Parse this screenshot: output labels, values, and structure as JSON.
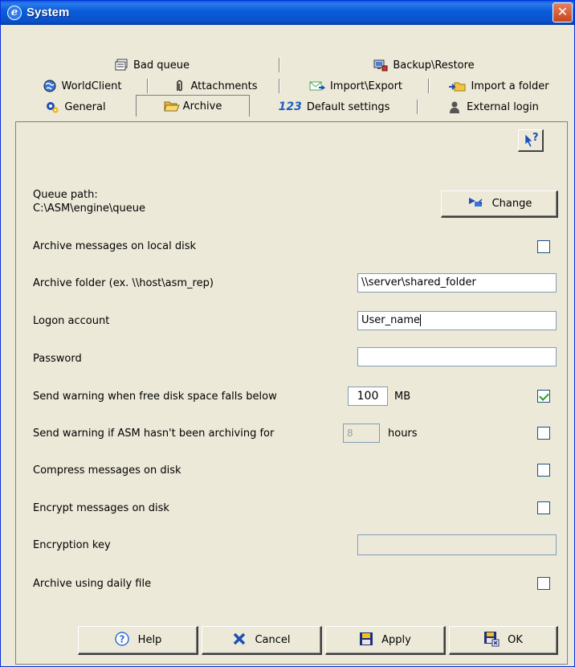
{
  "window": {
    "title": "System",
    "close_symbol": "✕"
  },
  "tabs": {
    "row1": [
      {
        "label": "Bad queue",
        "icon": "queue-icon"
      },
      {
        "label": "Backup\\Restore",
        "icon": "backup-icon"
      }
    ],
    "row2": [
      {
        "label": "WorldClient",
        "icon": "globe-icon"
      },
      {
        "label": "Attachments",
        "icon": "paperclip-icon"
      },
      {
        "label": "Import\\Export",
        "icon": "import-export-icon"
      },
      {
        "label": "Import a folder",
        "icon": "folder-import-icon"
      }
    ],
    "row3": [
      {
        "label": "General",
        "icon": "gear-icon"
      },
      {
        "label": "Archive",
        "icon": "folder-open-icon",
        "active": true
      },
      {
        "label": "Default settings",
        "icon": "numbers-icon",
        "icon_text": "123"
      },
      {
        "label": "External login",
        "icon": "user-icon"
      }
    ]
  },
  "context_help": {
    "icon": "whats-this-icon",
    "symbol": "?"
  },
  "queue": {
    "label": "Queue path:",
    "path": "C:\\ASM\\engine\\queue",
    "change_label": "Change"
  },
  "options": {
    "archive_local": {
      "label": "Archive messages on local disk",
      "checked": false
    },
    "archive_folder": {
      "label": "Archive folder (ex. \\\\host\\asm_rep)",
      "value": "\\\\server\\shared_folder"
    },
    "logon_account": {
      "label": "Logon account",
      "value": "User_name"
    },
    "password": {
      "label": "Password",
      "value": ""
    },
    "disk_warning": {
      "label": "Send warning when free disk space falls below",
      "value": "100",
      "unit": "MB",
      "checked": true
    },
    "archiving_warning": {
      "label": "Send warning if ASM hasn't been archiving for",
      "value": "8",
      "unit": "hours",
      "checked": false
    },
    "compress": {
      "label": "Compress messages on disk",
      "checked": false
    },
    "encrypt": {
      "label": "Encrypt messages on disk",
      "checked": false
    },
    "encryption_key": {
      "label": "Encryption key",
      "value": ""
    },
    "daily_file": {
      "label": "Archive using daily file",
      "checked": false
    }
  },
  "buttons": {
    "help": "Help",
    "cancel": "Cancel",
    "apply": "Apply",
    "ok": "OK"
  },
  "colors": {
    "titlebar": "#0a5ed8",
    "window_bg": "#ece9d8",
    "checkbox_border": "#1c5180",
    "check_mark": "#21a121",
    "cancel_x": "#1e4fb8",
    "help_circle": "#2f6fd6"
  }
}
